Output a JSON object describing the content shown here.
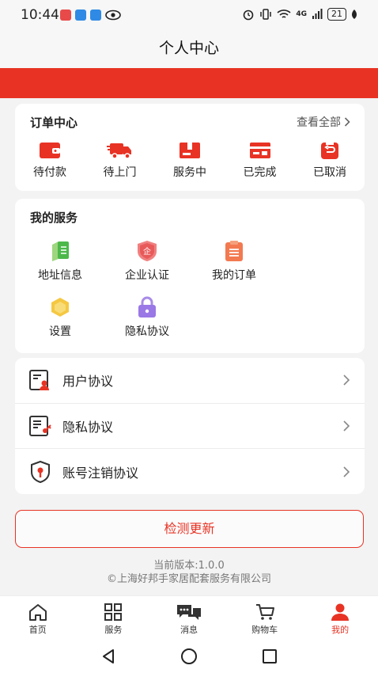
{
  "status_bar": {
    "time": "10:44",
    "battery": "21",
    "network": "4G"
  },
  "header": {
    "title": "个人中心"
  },
  "colors": {
    "brand": "#e83324",
    "background": "#f3f3f3"
  },
  "orders": {
    "title": "订单中心",
    "view_all": "查看全部",
    "items": [
      {
        "label": "待付款",
        "icon": "wallet-icon"
      },
      {
        "label": "待上门",
        "icon": "delivery-truck-icon"
      },
      {
        "label": "服务中",
        "icon": "service-box-icon"
      },
      {
        "label": "已完成",
        "icon": "completed-card-icon"
      },
      {
        "label": "已取消",
        "icon": "cancelled-return-icon"
      }
    ]
  },
  "services": {
    "title": "我的服务",
    "items": [
      {
        "label": "地址信息",
        "icon": "address-book-icon"
      },
      {
        "label": "企业认证",
        "icon": "enterprise-shield-icon"
      },
      {
        "label": "我的订单",
        "icon": "order-list-icon"
      },
      {
        "label": "设置",
        "icon": "settings-hexagon-icon"
      },
      {
        "label": "隐私协议",
        "icon": "privacy-lock-icon"
      }
    ]
  },
  "agreements": [
    {
      "label": "用户协议",
      "icon": "user-agreement-icon"
    },
    {
      "label": "隐私协议",
      "icon": "privacy-agreement-icon"
    },
    {
      "label": "账号注销协议",
      "icon": "account-cancel-icon"
    }
  ],
  "update_button": "检测更新",
  "version": {
    "line1": "当前版本:1.0.0",
    "line2": "©上海好邦手家居配套服务有限公司"
  },
  "tabbar": [
    {
      "label": "首页",
      "icon": "home-icon",
      "active": false
    },
    {
      "label": "服务",
      "icon": "grid-icon",
      "active": false
    },
    {
      "label": "消息",
      "icon": "chat-icon",
      "active": false
    },
    {
      "label": "购物车",
      "icon": "cart-icon",
      "active": false
    },
    {
      "label": "我的",
      "icon": "profile-icon",
      "active": true
    }
  ]
}
